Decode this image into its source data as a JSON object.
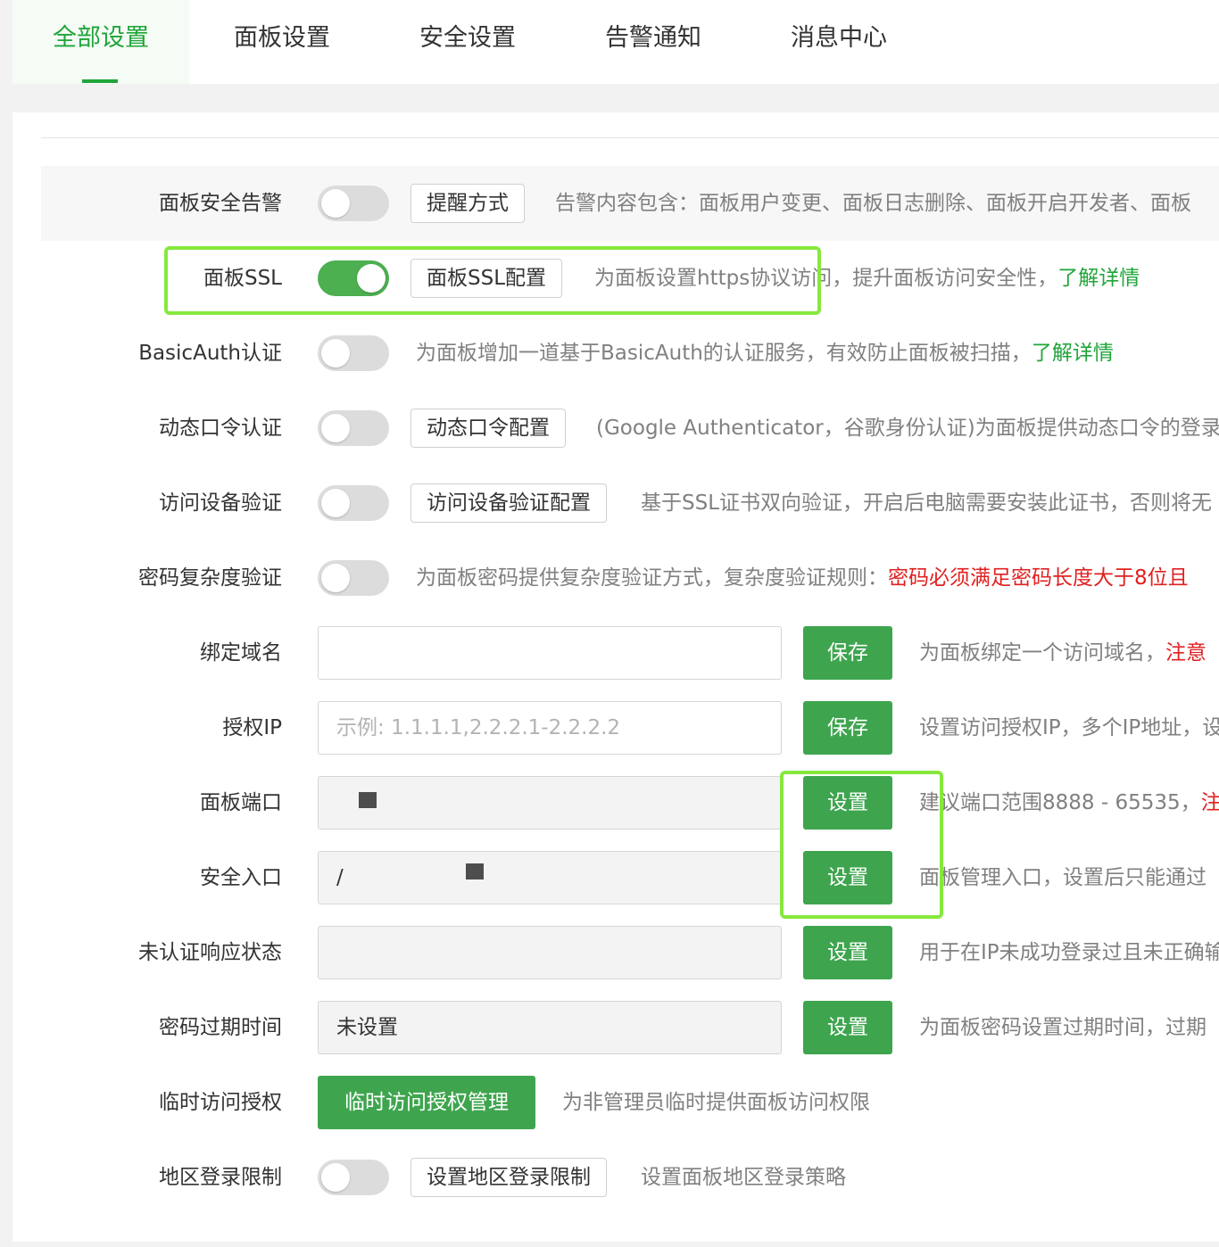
{
  "tabs": [
    {
      "label": "全部设置",
      "active": true
    },
    {
      "label": "面板设置",
      "active": false
    },
    {
      "label": "安全设置",
      "active": false
    },
    {
      "label": "告警通知",
      "active": false
    },
    {
      "label": "消息中心",
      "active": false
    }
  ],
  "rows": {
    "alert": {
      "label": "面板安全告警",
      "enabled": false,
      "button": "提醒方式",
      "desc": "告警内容包含：面板用户变更、面板日志删除、面板开启开发者、面板"
    },
    "ssl": {
      "label": "面板SSL",
      "enabled": true,
      "button": "面板SSL配置",
      "desc": "为面板设置https协议访问，提升面板访问安全性，",
      "link": "了解详情"
    },
    "basicauth": {
      "label": "BasicAuth认证",
      "enabled": false,
      "desc": "为面板增加一道基于BasicAuth的认证服务，有效防止面板被扫描，",
      "link": "了解详情"
    },
    "totp": {
      "label": "动态口令认证",
      "enabled": false,
      "button": "动态口令配置",
      "desc": "(Google Authenticator，谷歌身份认证)为面板提供动态口令的登录"
    },
    "device": {
      "label": "访问设备验证",
      "enabled": false,
      "button": "访问设备验证配置",
      "desc": "基于SSL证书双向验证，开启后电脑需要安装此证书，否则将无"
    },
    "password_complexity": {
      "label": "密码复杂度验证",
      "enabled": false,
      "desc": "为面板密码提供复杂度验证方式，复杂度验证规则：",
      "desc_red": "密码必须满足密码长度大于8位且"
    },
    "domain": {
      "label": "绑定域名",
      "value": "",
      "button": "保存",
      "desc": "为面板绑定一个访问域名，",
      "desc_red": "注意"
    },
    "auth_ip": {
      "label": "授权IP",
      "placeholder": "示例: 1.1.1.1,2.2.2.1-2.2.2.2",
      "button": "保存",
      "desc": "设置访问授权IP，多个IP地址，设"
    },
    "port": {
      "label": "面板端口",
      "button": "设置",
      "desc": "建议端口范围8888 - 65535，",
      "desc_red": "注"
    },
    "entry": {
      "label": "安全入口",
      "value_prefix": "/",
      "button": "设置",
      "desc": "面板管理入口，设置后只能通过"
    },
    "unauth_status": {
      "label": "未认证响应状态",
      "value": "",
      "button": "设置",
      "desc": "用于在IP未成功登录过且未正确输"
    },
    "password_expire": {
      "label": "密码过期时间",
      "value": "未设置",
      "button": "设置",
      "desc": "为面板密码设置过期时间，过期"
    },
    "temp_access": {
      "label": "临时访问授权",
      "button": "临时访问授权管理",
      "desc": "为非管理员临时提供面板访问权限"
    },
    "region_limit": {
      "label": "地区登录限制",
      "enabled": false,
      "button": "设置地区登录限制",
      "desc": "设置面板地区登录策略"
    }
  },
  "colors": {
    "accent": "#20a53a",
    "button_green": "#3ea54e",
    "highlight": "#86e83d",
    "warning_red": "#e02020"
  }
}
